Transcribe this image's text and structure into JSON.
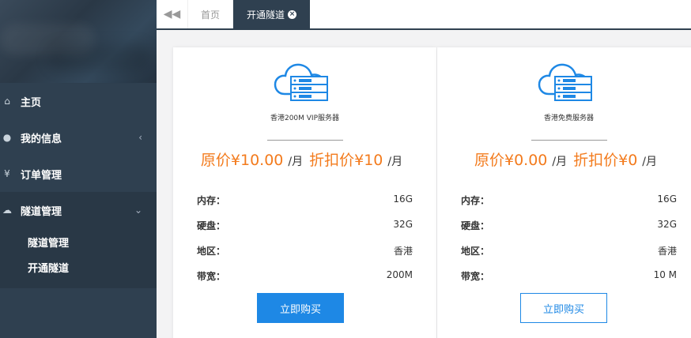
{
  "sidebar": {
    "items": [
      {
        "label": "主页",
        "icon": "home-icon"
      },
      {
        "label": "我的信息",
        "icon": "user-icon"
      },
      {
        "label": "订单管理",
        "icon": "yen-icon"
      },
      {
        "label": "隧道管理",
        "icon": "cloud-icon"
      }
    ],
    "sub_items": [
      "隧道管理",
      "开通隧道"
    ]
  },
  "tabs": {
    "home_label": "首页",
    "active_label": "开通隧道"
  },
  "products": [
    {
      "name": "香港200M VIP服务器",
      "original_label": "原价¥10.00",
      "unit1": "/月",
      "discount_label": "折扣价¥10",
      "unit2": "/月",
      "specs": [
        {
          "key": "内存：",
          "value": "16G"
        },
        {
          "key": "硬盘：",
          "value": "32G"
        },
        {
          "key": "地区：",
          "value": "香港"
        },
        {
          "key": "带宽：",
          "value": "200M"
        }
      ],
      "button": "立即购买"
    },
    {
      "name": "香港免费服务器",
      "original_label": "原价¥0.00",
      "unit1": "/月",
      "discount_label": "折扣价¥0",
      "unit2": "/月",
      "specs": [
        {
          "key": "内存：",
          "value": "16G"
        },
        {
          "key": "硬盘：",
          "value": "32G"
        },
        {
          "key": "地区：",
          "value": "香港"
        },
        {
          "key": "带宽：",
          "value": "10 M"
        }
      ],
      "button": "立即购买"
    }
  ],
  "colors": {
    "sidebar_bg": "#2f4050",
    "accent_orange": "#f37b1d",
    "primary_blue": "#1e88e5"
  }
}
